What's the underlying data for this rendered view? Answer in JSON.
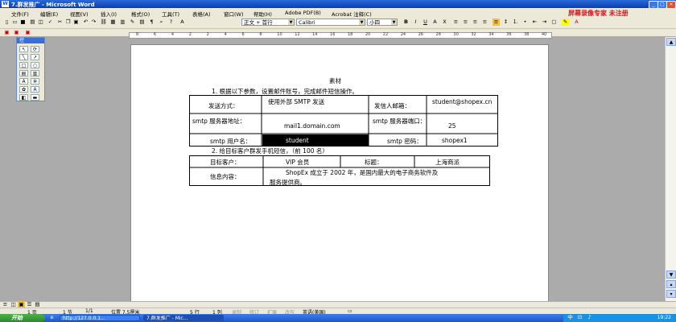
{
  "window": {
    "title": "7.群发推广 - Microsoft Word",
    "icon": "W"
  },
  "watermark": "屏幕录像专家 未注册",
  "menu": [
    "文件(F)",
    "编辑(E)",
    "视图(V)",
    "插入(I)",
    "格式(O)",
    "工具(T)",
    "表格(A)",
    "窗口(W)",
    "帮助(H)",
    "Adobe PDF(B)",
    "Acrobat 注释(C)"
  ],
  "toolbar": {
    "style": "正文 + 首行",
    "font": "Calibri",
    "size": "小四"
  },
  "ruler_ticks": [
    "8",
    "6",
    "4",
    "2",
    "2",
    "4",
    "6",
    "8",
    "10",
    "12",
    "14",
    "16",
    "18",
    "20",
    "22",
    "24",
    "26",
    "28",
    "30",
    "32",
    "34",
    "36",
    "38",
    "40"
  ],
  "left_panel": {
    "title": "控"
  },
  "document": {
    "heading": "素材",
    "step1": "1. 根据以下参数，设置邮件账号，完成邮件短信操作。",
    "table1": {
      "send_method_label": "发送方式：",
      "send_method_value": "使用外部 SMTP 发送",
      "sender_email_label": "发信人邮箱：",
      "sender_email_value": "student@shopex.cn",
      "smtp_server_label": "smtp 服务器地址：",
      "smtp_server_value": "mail1.domain.com",
      "smtp_port_label": "smtp 服务器端口：",
      "smtp_port_value": "25",
      "smtp_user_label": "smtp 用户名：",
      "smtp_user_value": "student",
      "smtp_pwd_label": "smtp 密码：",
      "smtp_pwd_value": "shopex1"
    },
    "step2": "2. 给目标客户群发手机短信，（前 100 名）",
    "table2": {
      "target_label": "目标客户：",
      "target_value": "VIP 会员",
      "title_label": "标题：",
      "title_value": "上海商派",
      "content_label": "信息内容：",
      "content_value_1": "ShopEx 成立于 2002 年，是国内最大的电子商务软件及",
      "content_value_2": "服务提供商。"
    }
  },
  "status": {
    "page": "1 页",
    "section": "1 节",
    "pages": "1/1",
    "position": "位置 7.5厘米",
    "line": "5 行",
    "col": "1 列",
    "rec": "录制",
    "trk": "修订",
    "ext": "扩展",
    "ovr": "改写",
    "lang": "英语(美国)"
  },
  "taskbar": {
    "start": "开始",
    "task1": "http://127.0.0.1...",
    "task2": "7.群发推广 - Mic...",
    "clock": "19:22"
  }
}
